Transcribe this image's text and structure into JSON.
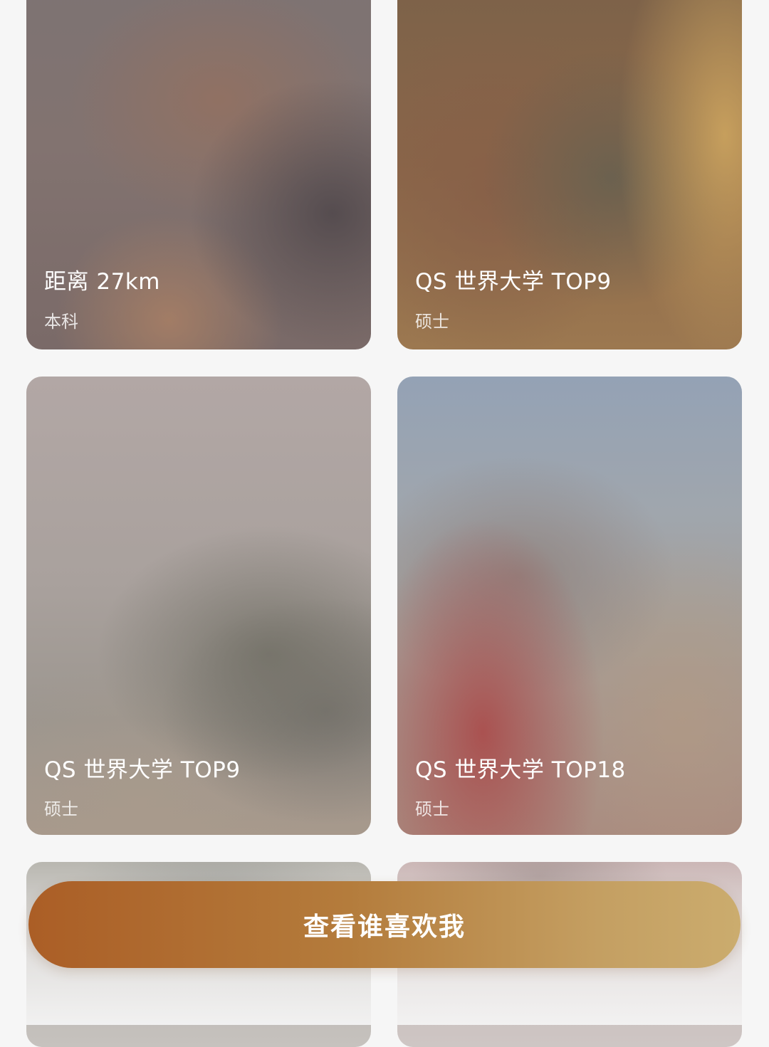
{
  "cards": [
    {
      "title": "距离 27km",
      "subtitle": "本科"
    },
    {
      "title": "QS 世界大学 TOP9",
      "subtitle": "硕士"
    },
    {
      "title": "QS 世界大学 TOP9",
      "subtitle": "硕士"
    },
    {
      "title": "QS 世界大学 TOP18",
      "subtitle": "硕士"
    },
    {
      "title": "",
      "subtitle": ""
    },
    {
      "title": "",
      "subtitle": ""
    }
  ],
  "cta": {
    "label": "查看谁喜欢我"
  },
  "colors": {
    "background": "#f6f6f6",
    "cta_gradient_start": "#ab5e26",
    "cta_gradient_end": "#cbac6e"
  }
}
